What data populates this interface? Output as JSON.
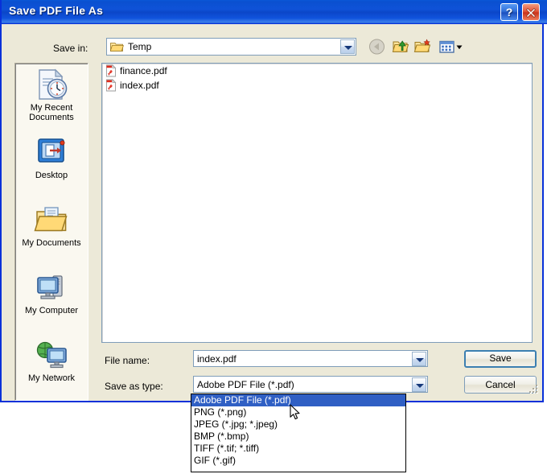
{
  "window": {
    "title": "Save PDF File As",
    "help_button": "?",
    "close_button": "✕"
  },
  "toolbar": {
    "savein_label": "Save in:",
    "savein_value": "Temp",
    "back_icon": "back-arrow-icon",
    "up_icon": "up-one-level-icon",
    "new_folder_icon": "new-folder-icon",
    "views_icon": "views-icon"
  },
  "places": [
    {
      "label": "My Recent Documents",
      "icon": "recent-documents-icon"
    },
    {
      "label": "Desktop",
      "icon": "desktop-icon"
    },
    {
      "label": "My Documents",
      "icon": "my-documents-icon"
    },
    {
      "label": "My Computer",
      "icon": "my-computer-icon"
    },
    {
      "label": "My Network",
      "icon": "my-network-icon"
    }
  ],
  "files": [
    {
      "name": "finance.pdf",
      "icon": "pdf-file-icon"
    },
    {
      "name": "index.pdf",
      "icon": "pdf-file-icon"
    }
  ],
  "form": {
    "filename_label": "File name:",
    "filename_value": "index.pdf",
    "savetype_label": "Save as type:",
    "savetype_value": "Adobe PDF File (*.pdf)",
    "save_button": "Save",
    "cancel_button": "Cancel"
  },
  "savetype_options": [
    "Adobe PDF File (*.pdf)",
    "PNG (*.png)",
    "JPEG (*.jpg; *.jpeg)",
    "BMP (*.bmp)",
    "TIFF (*.tif; *.tiff)",
    "GIF (*.gif)"
  ],
  "savetype_selected_index": 0,
  "colors": {
    "titlebar_blue": "#0a50d0",
    "dialog_face": "#ece9d8",
    "places_bg": "#faf8f0",
    "selection_blue": "#2f5fc4",
    "border_blue": "#0831d9"
  }
}
